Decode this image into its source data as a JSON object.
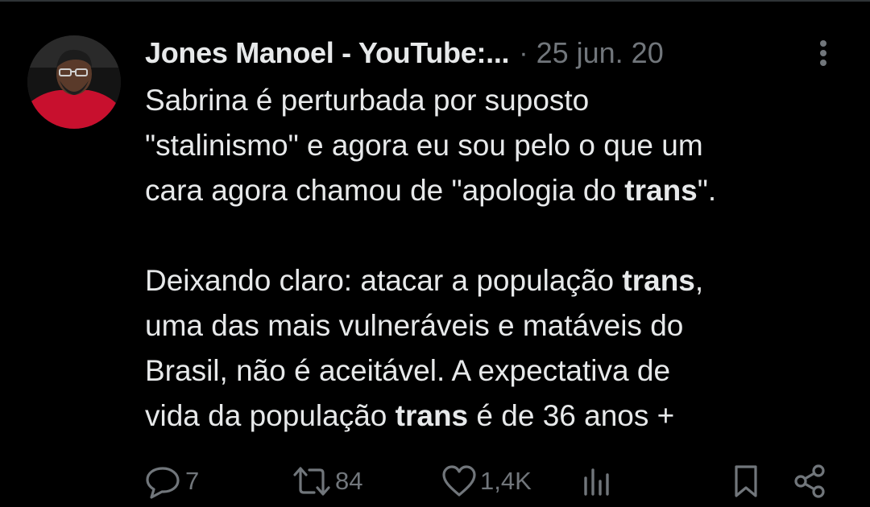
{
  "tweet": {
    "author_name": "Jones Manoel - YouTube:...",
    "separator": "·",
    "timestamp": "25 jun. 20",
    "text": {
      "line1": "Sabrina é perturbada por suposto",
      "line2": "\"stalinismo\" e agora eu sou pelo o que um",
      "line3_before": "cara agora chamou de \"apologia do ",
      "line3_bold": "trans",
      "line3_after": "\".",
      "line4_before": "Deixando claro: atacar a população ",
      "line4_bold": "trans",
      "line4_after": ",",
      "line5": "uma das mais vulneráveis e matáveis do",
      "line6": "Brasil, não é aceitável. A expectativa de",
      "line7_before": "vida da população ",
      "line7_bold": "trans",
      "line7_after": " é de 36 anos +"
    }
  },
  "actions": {
    "replies": "7",
    "reposts": "84",
    "likes": "1,4K"
  },
  "icons": {
    "more": "more-vertical-icon",
    "reply": "reply-icon",
    "repost": "repost-icon",
    "like": "heart-icon",
    "views": "analytics-icon",
    "bookmark": "bookmark-icon",
    "share": "share-icon"
  },
  "colors": {
    "background": "#000000",
    "text": "#e7e9ea",
    "muted": "#71767b",
    "avatar_red": "#c8102e"
  }
}
